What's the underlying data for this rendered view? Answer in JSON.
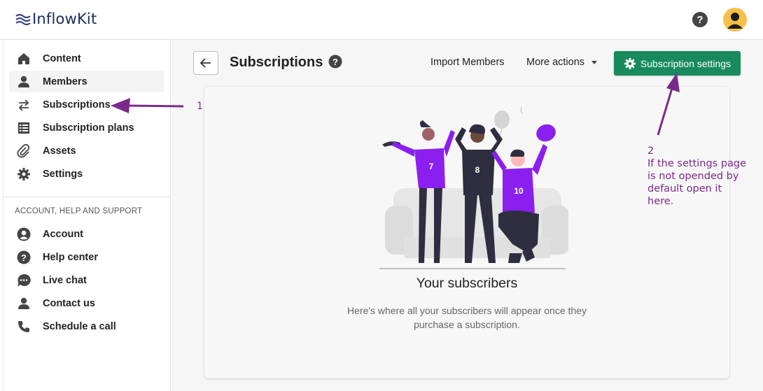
{
  "app": {
    "logo_text": "InflowKit"
  },
  "sidebar": {
    "items": [
      {
        "label": "Content",
        "icon": "home-icon"
      },
      {
        "label": "Members",
        "icon": "person-icon"
      },
      {
        "label": "Subscriptions",
        "icon": "swap-arrows-icon"
      },
      {
        "label": "Subscription plans",
        "icon": "list-icon"
      },
      {
        "label": "Assets",
        "icon": "paperclip-icon"
      },
      {
        "label": "Settings",
        "icon": "gear-icon"
      }
    ],
    "section_label": "ACCOUNT, HELP AND SUPPORT",
    "support_items": [
      {
        "label": "Account",
        "icon": "account-circle-icon"
      },
      {
        "label": "Help center",
        "icon": "help-circle-icon"
      },
      {
        "label": "Live chat",
        "icon": "chat-bubble-icon"
      },
      {
        "label": "Contact us",
        "icon": "person-icon"
      },
      {
        "label": "Schedule a call",
        "icon": "phone-icon"
      }
    ]
  },
  "header": {
    "title": "Subscriptions",
    "import_label": "Import Members",
    "more_label": "More actions",
    "settings_label": "Subscription settings"
  },
  "empty_state": {
    "title": "Your subscribers",
    "description": "Here's where all your subscribers will appear once they purchase a subscription.",
    "jersey_numbers": [
      "7",
      "8",
      "10"
    ]
  },
  "annotations": {
    "label_1": "1",
    "label_2_number": "2",
    "label_2_lines": [
      "If the settings page",
      "is not opended by",
      "default open it",
      "here."
    ]
  },
  "colors": {
    "accent_green": "#188a5e",
    "annotation_purple": "#7a2a8a",
    "illustration_purple": "#8b1ff0"
  }
}
